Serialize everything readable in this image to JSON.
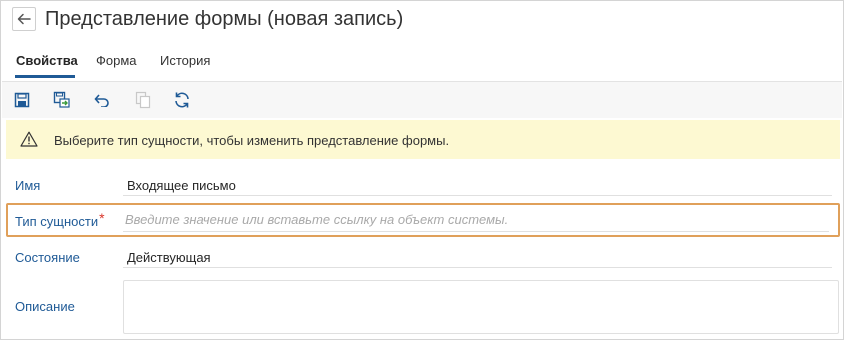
{
  "header": {
    "title": "Представление формы (новая запись)",
    "back_icon": "arrow-left-icon"
  },
  "tabs": [
    {
      "label": "Свойства",
      "active": true
    },
    {
      "label": "Форма",
      "active": false
    },
    {
      "label": "История",
      "active": false
    }
  ],
  "toolbar": {
    "buttons": [
      {
        "icon": "save-icon",
        "enabled": true
      },
      {
        "icon": "save-and-close-icon",
        "enabled": true
      },
      {
        "icon": "undo-icon",
        "enabled": true
      },
      {
        "icon": "copy-icon",
        "enabled": false
      },
      {
        "icon": "refresh-icon",
        "enabled": true
      }
    ]
  },
  "warning": {
    "icon": "warning-triangle-icon",
    "text": "Выберите тип сущности, чтобы изменить представление формы."
  },
  "fields": {
    "name": {
      "label": "Имя",
      "value": "Входящее письмо"
    },
    "entity_type": {
      "label": "Тип сущности",
      "required_mark": "*",
      "value": "",
      "placeholder": "Введите значение или вставьте ссылку на объект системы."
    },
    "state": {
      "label": "Состояние",
      "value": "Действующая"
    },
    "description": {
      "label": "Описание",
      "value": ""
    }
  },
  "colors": {
    "accent": "#1f5a96",
    "warning_bg": "#fdf9d2",
    "highlight_border": "#e0a05a",
    "required": "#d9352a"
  }
}
